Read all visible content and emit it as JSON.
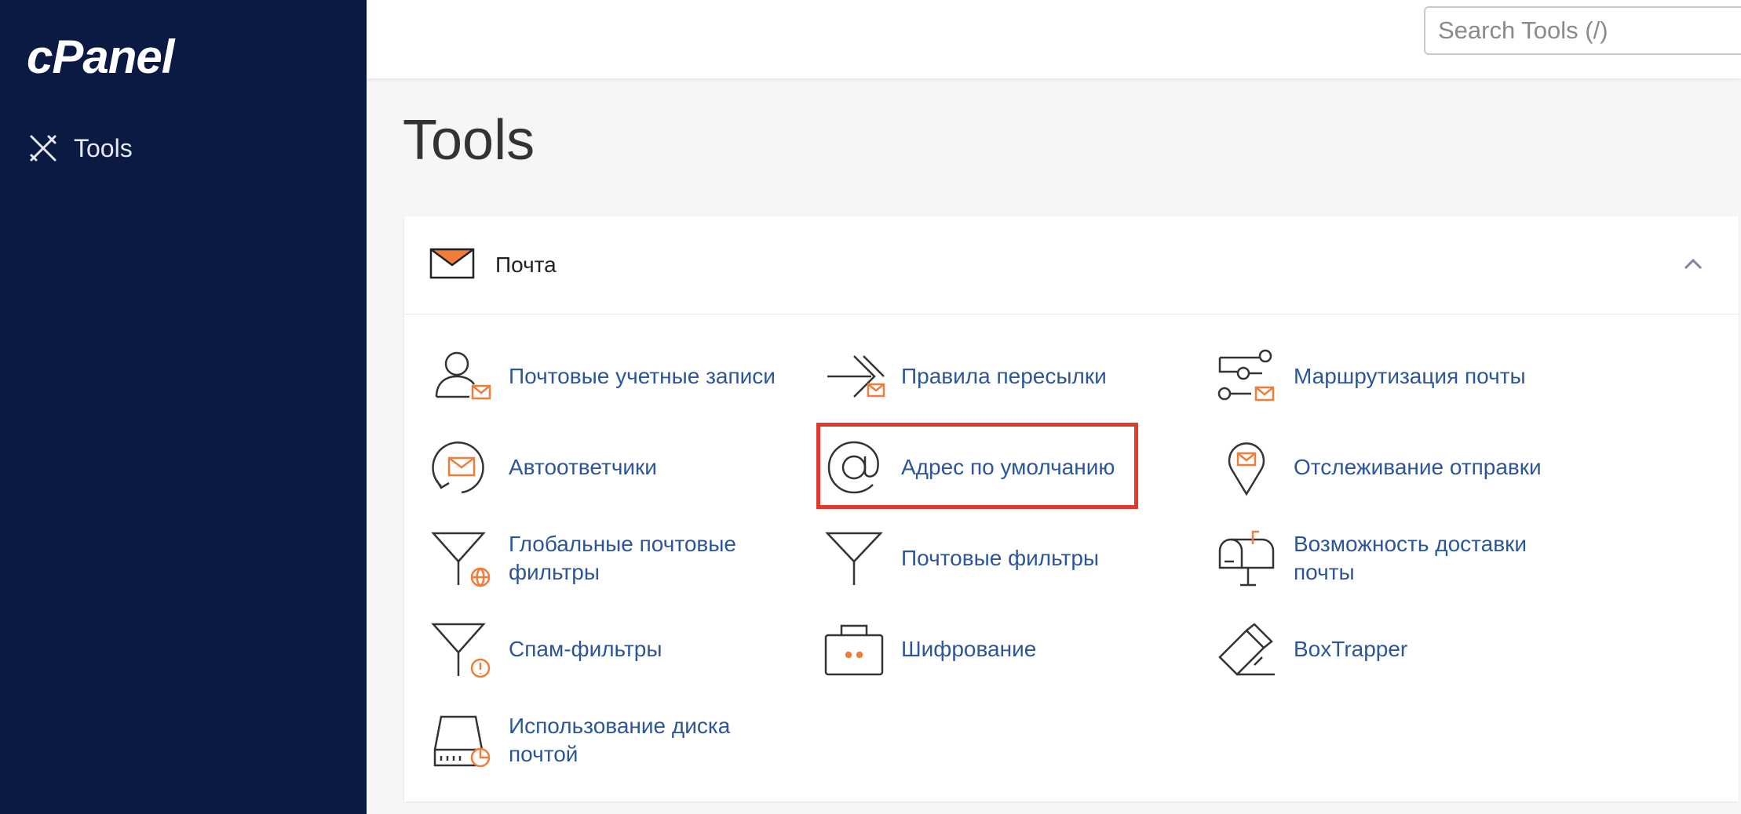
{
  "brand": {
    "logo_text": "cPanel"
  },
  "sidebar": {
    "tools_label": "Tools"
  },
  "search": {
    "placeholder": "Search Tools (/)"
  },
  "page": {
    "title": "Tools"
  },
  "section": {
    "title": "Почта",
    "tools": [
      {
        "label": "Почтовые учетные записи",
        "icon": "email-accounts-icon"
      },
      {
        "label": "Правила пересылки",
        "icon": "forwarders-icon"
      },
      {
        "label": "Маршрутизация почты",
        "icon": "email-routing-icon"
      },
      {
        "label": "Автоответчики",
        "icon": "autoresponders-icon"
      },
      {
        "label": "Адрес по умолчанию",
        "icon": "default-address-icon"
      },
      {
        "label": "Отслеживание отправки",
        "icon": "track-delivery-icon"
      },
      {
        "label": "Глобальные почтовые фильтры",
        "icon": "global-filters-icon"
      },
      {
        "label": "Почтовые фильтры",
        "icon": "email-filters-icon"
      },
      {
        "label": "Возможность доставки почты",
        "icon": "email-deliverability-icon"
      },
      {
        "label": "Спам-фильтры",
        "icon": "spam-filters-icon"
      },
      {
        "label": "Шифрование",
        "icon": "encryption-icon"
      },
      {
        "label": "BoxTrapper",
        "icon": "boxtrapper-icon"
      },
      {
        "label": "Использование диска почтой",
        "icon": "email-disk-usage-icon"
      }
    ]
  },
  "colors": {
    "sidebar_bg": "#0b1a42",
    "link": "#2c5699",
    "accent": "#f07e3a",
    "highlight": "#e03a2f"
  }
}
